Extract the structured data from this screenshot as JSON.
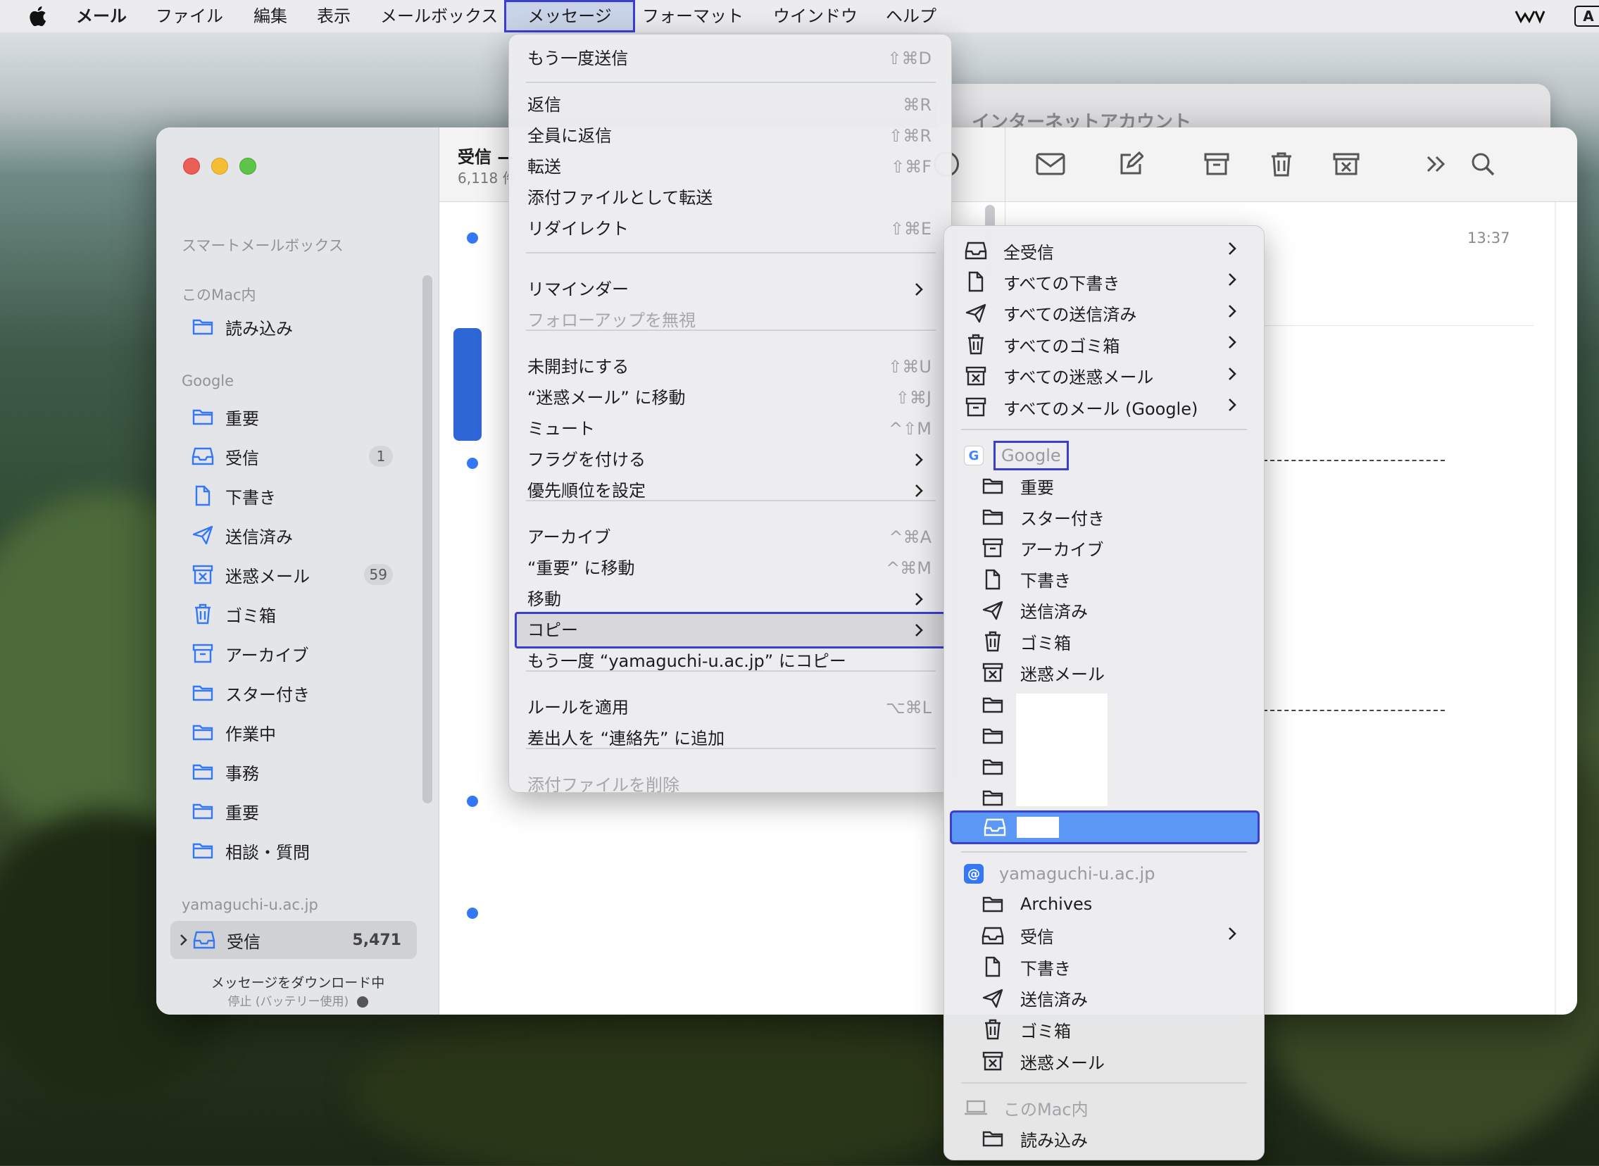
{
  "menubar": {
    "app_name": "メール",
    "items": [
      "ファイル",
      "編集",
      "表示",
      "メールボックス",
      "メッセージ",
      "フォーマット",
      "ウインドウ",
      "ヘルプ"
    ],
    "status_letter": "A"
  },
  "back_window": {
    "title": "インターネットアカウント"
  },
  "window": {
    "mailbox_title": "受信 —",
    "mailbox_count": "6,118 件",
    "message_time": "13:37"
  },
  "sidebar": {
    "smart_header": "スマートメールボックス",
    "mac_header": "このMac内",
    "mac_items": [
      {
        "label": "読み込み",
        "icon": "folder-icon"
      }
    ],
    "google_header": "Google",
    "google_items": [
      {
        "label": "重要",
        "icon": "folder-icon",
        "badge": ""
      },
      {
        "label": "受信",
        "icon": "inbox-icon",
        "badge": "1"
      },
      {
        "label": "下書き",
        "icon": "document-icon",
        "badge": ""
      },
      {
        "label": "送信済み",
        "icon": "paper-plane-icon",
        "badge": ""
      },
      {
        "label": "迷惑メール",
        "icon": "junk-icon",
        "badge": "59"
      },
      {
        "label": "ゴミ箱",
        "icon": "trash-icon",
        "badge": ""
      },
      {
        "label": "アーカイブ",
        "icon": "archive-icon",
        "badge": ""
      },
      {
        "label": "スター付き",
        "icon": "folder-icon",
        "badge": ""
      },
      {
        "label": "作業中",
        "icon": "folder-icon",
        "badge": ""
      },
      {
        "label": "事務",
        "icon": "folder-icon",
        "badge": ""
      },
      {
        "label": "重要",
        "icon": "folder-icon",
        "badge": ""
      },
      {
        "label": "相談・質問",
        "icon": "folder-icon",
        "badge": ""
      }
    ],
    "yamaguchi_header": "yamaguchi-u.ac.jp",
    "yamaguchi_inbox": {
      "label": "受信",
      "badge": "5,471"
    },
    "status_line1": "メッセージをダウンロード中",
    "status_line2": "停止 (バッテリー使用)"
  },
  "message_menu": {
    "items": [
      {
        "label": "もう一度送信",
        "shortcut": "⇧⌘D",
        "enabled": true
      },
      {
        "label": "返信",
        "shortcut": "⌘R",
        "enabled": true
      },
      {
        "label": "全員に返信",
        "shortcut": "⇧⌘R",
        "enabled": true
      },
      {
        "label": "転送",
        "shortcut": "⇧⌘F",
        "enabled": true
      },
      {
        "label": "添付ファイルとして転送",
        "shortcut": "",
        "enabled": true
      },
      {
        "label": "リダイレクト",
        "shortcut": "⇧⌘E",
        "enabled": true
      },
      {
        "label": "リマインダー",
        "shortcut": "",
        "submenu": true,
        "enabled": true
      },
      {
        "label": "フォローアップを無視",
        "shortcut": "",
        "enabled": false
      },
      {
        "label": "未開封にする",
        "shortcut": "⇧⌘U",
        "enabled": true
      },
      {
        "label": "“迷惑メール” に移動",
        "shortcut": "⇧⌘J",
        "enabled": true
      },
      {
        "label": "ミュート",
        "shortcut": "^⇧M",
        "enabled": true
      },
      {
        "label": "フラグを付ける",
        "shortcut": "",
        "submenu": true,
        "enabled": true
      },
      {
        "label": "優先順位を設定",
        "shortcut": "",
        "submenu": true,
        "enabled": true
      },
      {
        "label": "アーカイブ",
        "shortcut": "^⌘A",
        "enabled": true
      },
      {
        "label": "“重要” に移動",
        "shortcut": "^⌘M",
        "enabled": true
      },
      {
        "label": "移動",
        "shortcut": "",
        "submenu": true,
        "enabled": true
      },
      {
        "label": "コピー",
        "shortcut": "",
        "submenu": true,
        "enabled": true,
        "selected": true
      },
      {
        "label": "もう一度 “yamaguchi-u.ac.jp” にコピー",
        "shortcut": "",
        "enabled": true
      },
      {
        "label": "ルールを適用",
        "shortcut": "⌥⌘L",
        "enabled": true
      },
      {
        "label": "差出人を “連絡先” に追加",
        "shortcut": "",
        "enabled": true
      },
      {
        "label": "添付ファイルを削除",
        "shortcut": "",
        "enabled": false
      }
    ]
  },
  "copy_submenu": {
    "all_items": [
      {
        "label": "全受信",
        "icon": "inbox-icon"
      },
      {
        "label": "すべての下書き",
        "icon": "document-icon"
      },
      {
        "label": "すべての送信済み",
        "icon": "paper-plane-icon"
      },
      {
        "label": "すべてのゴミ箱",
        "icon": "trash-icon"
      },
      {
        "label": "すべての迷惑メール",
        "icon": "junk-icon"
      },
      {
        "label": "すべてのメール (Google)",
        "icon": "archive-icon"
      }
    ],
    "google_header": "Google",
    "google_items": [
      {
        "label": "重要",
        "icon": "folder-icon"
      },
      {
        "label": "スター付き",
        "icon": "folder-icon"
      },
      {
        "label": "アーカイブ",
        "icon": "archive-icon"
      },
      {
        "label": "下書き",
        "icon": "document-icon"
      },
      {
        "label": "送信済み",
        "icon": "paper-plane-icon"
      },
      {
        "label": "ゴミ箱",
        "icon": "trash-icon"
      },
      {
        "label": "迷惑メール",
        "icon": "junk-icon"
      }
    ],
    "yamaguchi_header": "yamaguchi-u.ac.jp",
    "yamaguchi_items": [
      {
        "label": "Archives",
        "icon": "folder-icon"
      },
      {
        "label": "受信",
        "icon": "inbox-icon"
      },
      {
        "label": "下書き",
        "icon": "document-icon"
      },
      {
        "label": "送信済み",
        "icon": "paper-plane-icon"
      },
      {
        "label": "ゴミ箱",
        "icon": "trash-icon"
      },
      {
        "label": "迷惑メール",
        "icon": "junk-icon"
      }
    ],
    "mac_header": "このMac内",
    "mac_items": [
      {
        "label": "読み込み",
        "icon": "folder-icon"
      }
    ]
  },
  "colors": {
    "accent": "#3478f6",
    "highlight_box": "#3b3fd1",
    "selected_row": "#5b98f5"
  }
}
